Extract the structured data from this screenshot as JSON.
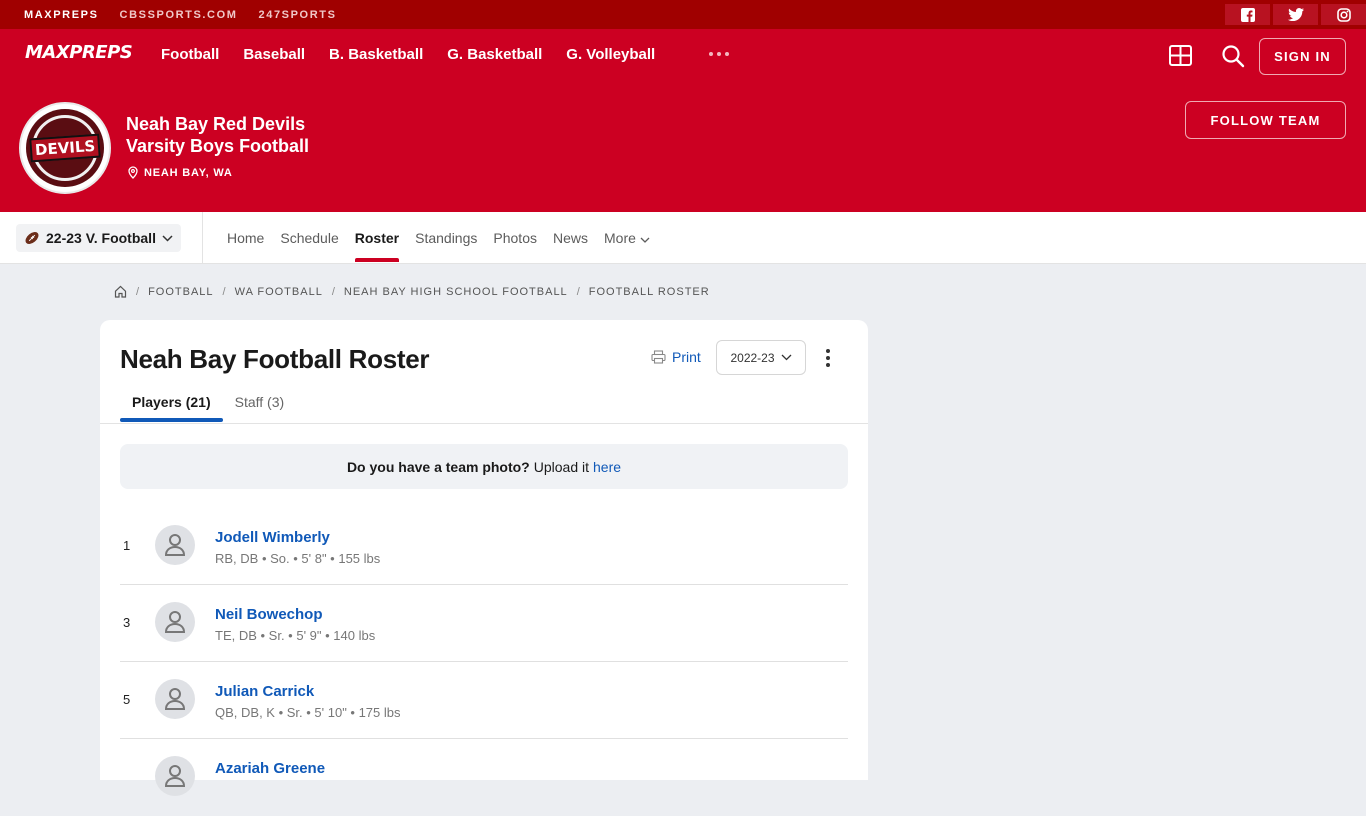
{
  "topbar": {
    "brand_links": [
      "MAXPREPS",
      "CBSSPORTS.COM",
      "247SPORTS"
    ],
    "social_icons": [
      "facebook-icon",
      "twitter-icon",
      "instagram-icon"
    ]
  },
  "nav": {
    "logo_text": "MAXPREPS",
    "sports": [
      "Football",
      "Baseball",
      "B. Basketball",
      "G. Basketball",
      "G. Volleyball"
    ],
    "sign_in": "SIGN IN"
  },
  "team": {
    "name_line1": "Neah Bay Red Devils",
    "name_line2": "Varsity Boys Football",
    "location": "NEAH BAY, WA",
    "logo_text": "DEVILS",
    "follow": "FOLLOW TEAM"
  },
  "subnav": {
    "season": "22-23 V. Football",
    "tabs": [
      "Home",
      "Schedule",
      "Roster",
      "Standings",
      "Photos",
      "News",
      "More"
    ],
    "active_tab": "Roster"
  },
  "breadcrumb": [
    "FOOTBALL",
    "WA FOOTBALL",
    "NEAH BAY HIGH SCHOOL FOOTBALL",
    "FOOTBALL ROSTER"
  ],
  "roster": {
    "title": "Neah Bay Football Roster",
    "print": "Print",
    "year": "2022-23",
    "tabs": [
      "Players (21)",
      "Staff (3)"
    ],
    "photo_prompt_bold": "Do you have a team photo?",
    "photo_prompt_text": "Upload it",
    "photo_prompt_link": "here",
    "players": [
      {
        "number": "1",
        "name": "Jodell Wimberly",
        "meta": "RB, DB • So. • 5' 8\" • 155 lbs"
      },
      {
        "number": "3",
        "name": "Neil Bowechop",
        "meta": "TE, DB • Sr. • 5' 9\" • 140 lbs"
      },
      {
        "number": "5",
        "name": "Julian Carrick",
        "meta": "QB, DB, K • Sr. • 5' 10\" • 175 lbs"
      },
      {
        "number": "",
        "name": "Azariah Greene",
        "meta": ""
      }
    ]
  },
  "colors": {
    "brand_red": "#cc0022",
    "dark_red": "#a00000",
    "link_blue": "#1059b8"
  }
}
